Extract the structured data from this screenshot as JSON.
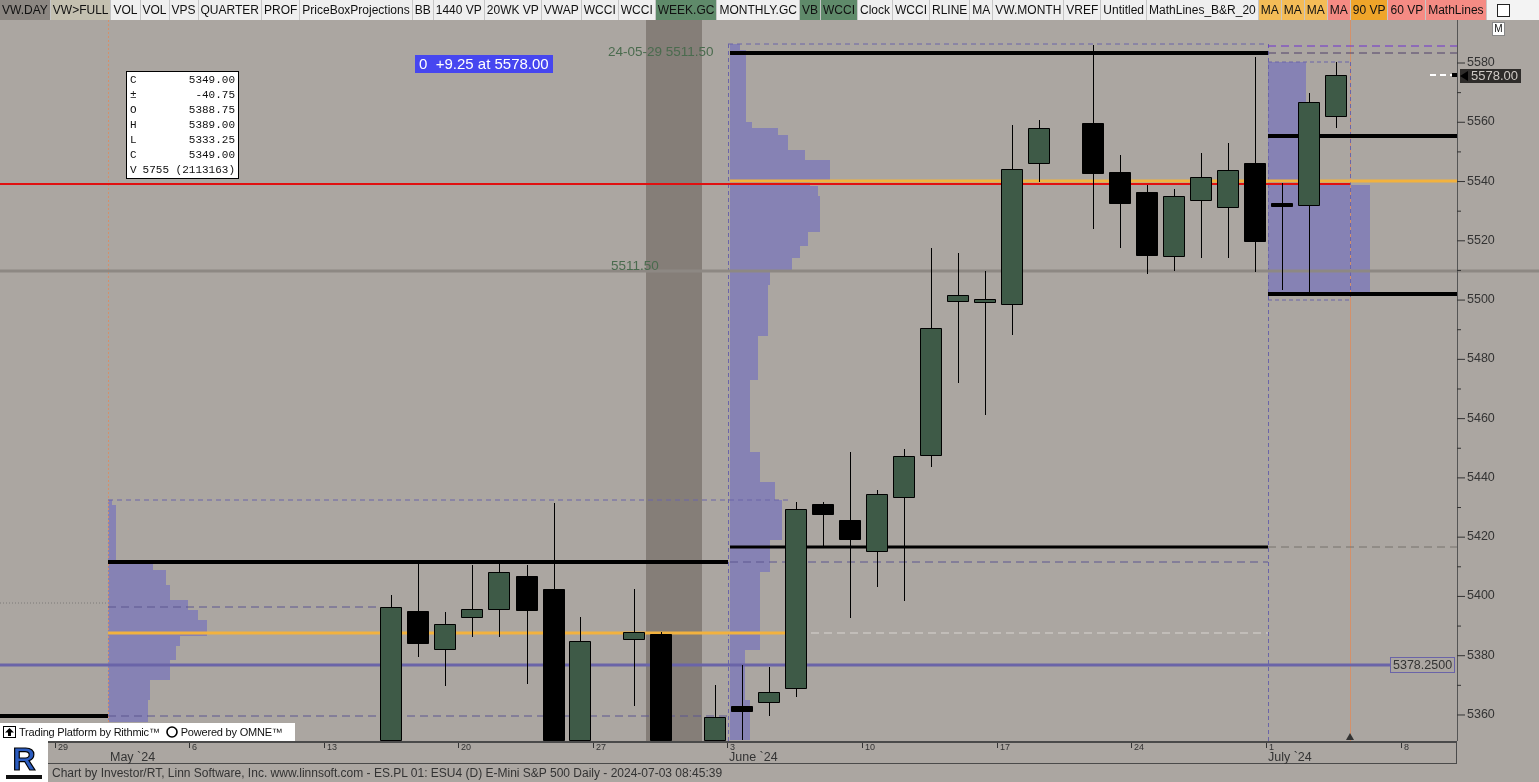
{
  "toolbar": {
    "buttons": [
      {
        "label": "VW.DAY",
        "color": "#8c8782"
      },
      {
        "label": "VW>FULL",
        "color": "#c4c0b0"
      },
      {
        "label": "VOL",
        "color": "#efefef"
      },
      {
        "label": "VOL",
        "color": "#efefef"
      },
      {
        "label": "VPS",
        "color": "#efefef"
      },
      {
        "label": "QUARTER",
        "color": "#efefef"
      },
      {
        "label": "PROF",
        "color": "#efefef"
      },
      {
        "label": "PriceBoxProjections",
        "color": "#efefef"
      },
      {
        "label": "BB",
        "color": "#efefef"
      },
      {
        "label": "1440 VP",
        "color": "#efefef"
      },
      {
        "label": "20WK VP",
        "color": "#efefef"
      },
      {
        "label": "VWAP",
        "color": "#efefef"
      },
      {
        "label": "WCCI",
        "color": "#efefef"
      },
      {
        "label": "WCCI",
        "color": "#efefef"
      },
      {
        "label": "WEEK.GC",
        "color": "#5f8a6a"
      },
      {
        "label": "MONTHLY.GC",
        "color": "#efefef"
      },
      {
        "label": "VB",
        "color": "#5f8a6a"
      },
      {
        "label": "WCCI",
        "color": "#5f8a6a"
      },
      {
        "label": "Clock",
        "color": "#efefef"
      },
      {
        "label": "WCCI",
        "color": "#efefef"
      },
      {
        "label": "RLINE",
        "color": "#efefef"
      },
      {
        "label": "MA",
        "color": "#efefef"
      },
      {
        "label": "VW.MONTH",
        "color": "#efefef"
      },
      {
        "label": "VREF",
        "color": "#efefef"
      },
      {
        "label": "Untitled",
        "color": "#efefef"
      },
      {
        "label": "MathLines_B&R_20",
        "color": "#efefef"
      },
      {
        "label": "MA",
        "color": "#f4bc57"
      },
      {
        "label": "MA",
        "color": "#f4bc57"
      },
      {
        "label": "MA",
        "color": "#f4bc57"
      },
      {
        "label": "MA",
        "color": "#f58b84"
      },
      {
        "label": "90 VP",
        "color": "#efa52a"
      },
      {
        "label": "60 VP",
        "color": "#f58b84"
      },
      {
        "label": "MathLines",
        "color": "#f58b84"
      }
    ]
  },
  "chart": {
    "marker_label": "M",
    "change_label": "0  +9.25 at 5578.00",
    "data_window": {
      "rows": [
        {
          "label": "C",
          "value": "5349.00"
        },
        {
          "label": "±",
          "value": "-40.75"
        },
        {
          "label": "O",
          "value": "5388.75"
        },
        {
          "label": "H",
          "value": "5389.00"
        },
        {
          "label": "L",
          "value": "5333.25"
        },
        {
          "label": "C",
          "value": "5349.00"
        },
        {
          "label": "V",
          "value": "5755 (2113163)"
        }
      ]
    },
    "profile_labels": [
      "24-05-29 5511.50",
      "5511.50"
    ],
    "last_price": "5578.00",
    "level_label": "5378.2500",
    "price_axis": [
      "5580",
      "5560",
      "5540",
      "5520",
      "5500",
      "5480",
      "5460",
      "5440",
      "5420",
      "5400",
      "5380",
      "5360"
    ],
    "time_axis": {
      "day_ticks": [
        "29",
        "6",
        "13",
        "20",
        "27",
        "3",
        "10",
        "17",
        "24",
        "1",
        "8"
      ],
      "months": [
        "May `24",
        "June `24",
        "July `24"
      ]
    }
  },
  "branding": {
    "platform": "Trading Platform by Rithmic™",
    "powered_by": "Powered by OMNE™"
  },
  "footer": {
    "logo": "R",
    "status": "Chart by Investor/RT, Linn Software, Inc. www.linnsoft.com - ES.PL 01: ESU4 (D) E-Mini S&P 500 Daily - 2024-07-03 08:45:39"
  }
}
